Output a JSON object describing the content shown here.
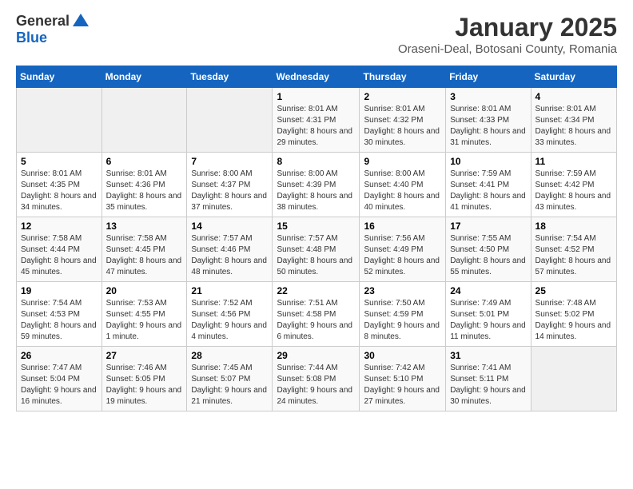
{
  "logo": {
    "general": "General",
    "blue": "Blue"
  },
  "title": "January 2025",
  "subtitle": "Oraseni-Deal, Botosani County, Romania",
  "days_of_week": [
    "Sunday",
    "Monday",
    "Tuesday",
    "Wednesday",
    "Thursday",
    "Friday",
    "Saturday"
  ],
  "weeks": [
    [
      {
        "day": "",
        "detail": ""
      },
      {
        "day": "",
        "detail": ""
      },
      {
        "day": "",
        "detail": ""
      },
      {
        "day": "1",
        "detail": "Sunrise: 8:01 AM\nSunset: 4:31 PM\nDaylight: 8 hours and 29 minutes."
      },
      {
        "day": "2",
        "detail": "Sunrise: 8:01 AM\nSunset: 4:32 PM\nDaylight: 8 hours and 30 minutes."
      },
      {
        "day": "3",
        "detail": "Sunrise: 8:01 AM\nSunset: 4:33 PM\nDaylight: 8 hours and 31 minutes."
      },
      {
        "day": "4",
        "detail": "Sunrise: 8:01 AM\nSunset: 4:34 PM\nDaylight: 8 hours and 33 minutes."
      }
    ],
    [
      {
        "day": "5",
        "detail": "Sunrise: 8:01 AM\nSunset: 4:35 PM\nDaylight: 8 hours and 34 minutes."
      },
      {
        "day": "6",
        "detail": "Sunrise: 8:01 AM\nSunset: 4:36 PM\nDaylight: 8 hours and 35 minutes."
      },
      {
        "day": "7",
        "detail": "Sunrise: 8:00 AM\nSunset: 4:37 PM\nDaylight: 8 hours and 37 minutes."
      },
      {
        "day": "8",
        "detail": "Sunrise: 8:00 AM\nSunset: 4:39 PM\nDaylight: 8 hours and 38 minutes."
      },
      {
        "day": "9",
        "detail": "Sunrise: 8:00 AM\nSunset: 4:40 PM\nDaylight: 8 hours and 40 minutes."
      },
      {
        "day": "10",
        "detail": "Sunrise: 7:59 AM\nSunset: 4:41 PM\nDaylight: 8 hours and 41 minutes."
      },
      {
        "day": "11",
        "detail": "Sunrise: 7:59 AM\nSunset: 4:42 PM\nDaylight: 8 hours and 43 minutes."
      }
    ],
    [
      {
        "day": "12",
        "detail": "Sunrise: 7:58 AM\nSunset: 4:44 PM\nDaylight: 8 hours and 45 minutes."
      },
      {
        "day": "13",
        "detail": "Sunrise: 7:58 AM\nSunset: 4:45 PM\nDaylight: 8 hours and 47 minutes."
      },
      {
        "day": "14",
        "detail": "Sunrise: 7:57 AM\nSunset: 4:46 PM\nDaylight: 8 hours and 48 minutes."
      },
      {
        "day": "15",
        "detail": "Sunrise: 7:57 AM\nSunset: 4:48 PM\nDaylight: 8 hours and 50 minutes."
      },
      {
        "day": "16",
        "detail": "Sunrise: 7:56 AM\nSunset: 4:49 PM\nDaylight: 8 hours and 52 minutes."
      },
      {
        "day": "17",
        "detail": "Sunrise: 7:55 AM\nSunset: 4:50 PM\nDaylight: 8 hours and 55 minutes."
      },
      {
        "day": "18",
        "detail": "Sunrise: 7:54 AM\nSunset: 4:52 PM\nDaylight: 8 hours and 57 minutes."
      }
    ],
    [
      {
        "day": "19",
        "detail": "Sunrise: 7:54 AM\nSunset: 4:53 PM\nDaylight: 8 hours and 59 minutes."
      },
      {
        "day": "20",
        "detail": "Sunrise: 7:53 AM\nSunset: 4:55 PM\nDaylight: 9 hours and 1 minute."
      },
      {
        "day": "21",
        "detail": "Sunrise: 7:52 AM\nSunset: 4:56 PM\nDaylight: 9 hours and 4 minutes."
      },
      {
        "day": "22",
        "detail": "Sunrise: 7:51 AM\nSunset: 4:58 PM\nDaylight: 9 hours and 6 minutes."
      },
      {
        "day": "23",
        "detail": "Sunrise: 7:50 AM\nSunset: 4:59 PM\nDaylight: 9 hours and 8 minutes."
      },
      {
        "day": "24",
        "detail": "Sunrise: 7:49 AM\nSunset: 5:01 PM\nDaylight: 9 hours and 11 minutes."
      },
      {
        "day": "25",
        "detail": "Sunrise: 7:48 AM\nSunset: 5:02 PM\nDaylight: 9 hours and 14 minutes."
      }
    ],
    [
      {
        "day": "26",
        "detail": "Sunrise: 7:47 AM\nSunset: 5:04 PM\nDaylight: 9 hours and 16 minutes."
      },
      {
        "day": "27",
        "detail": "Sunrise: 7:46 AM\nSunset: 5:05 PM\nDaylight: 9 hours and 19 minutes."
      },
      {
        "day": "28",
        "detail": "Sunrise: 7:45 AM\nSunset: 5:07 PM\nDaylight: 9 hours and 21 minutes."
      },
      {
        "day": "29",
        "detail": "Sunrise: 7:44 AM\nSunset: 5:08 PM\nDaylight: 9 hours and 24 minutes."
      },
      {
        "day": "30",
        "detail": "Sunrise: 7:42 AM\nSunset: 5:10 PM\nDaylight: 9 hours and 27 minutes."
      },
      {
        "day": "31",
        "detail": "Sunrise: 7:41 AM\nSunset: 5:11 PM\nDaylight: 9 hours and 30 minutes."
      },
      {
        "day": "",
        "detail": ""
      }
    ]
  ]
}
